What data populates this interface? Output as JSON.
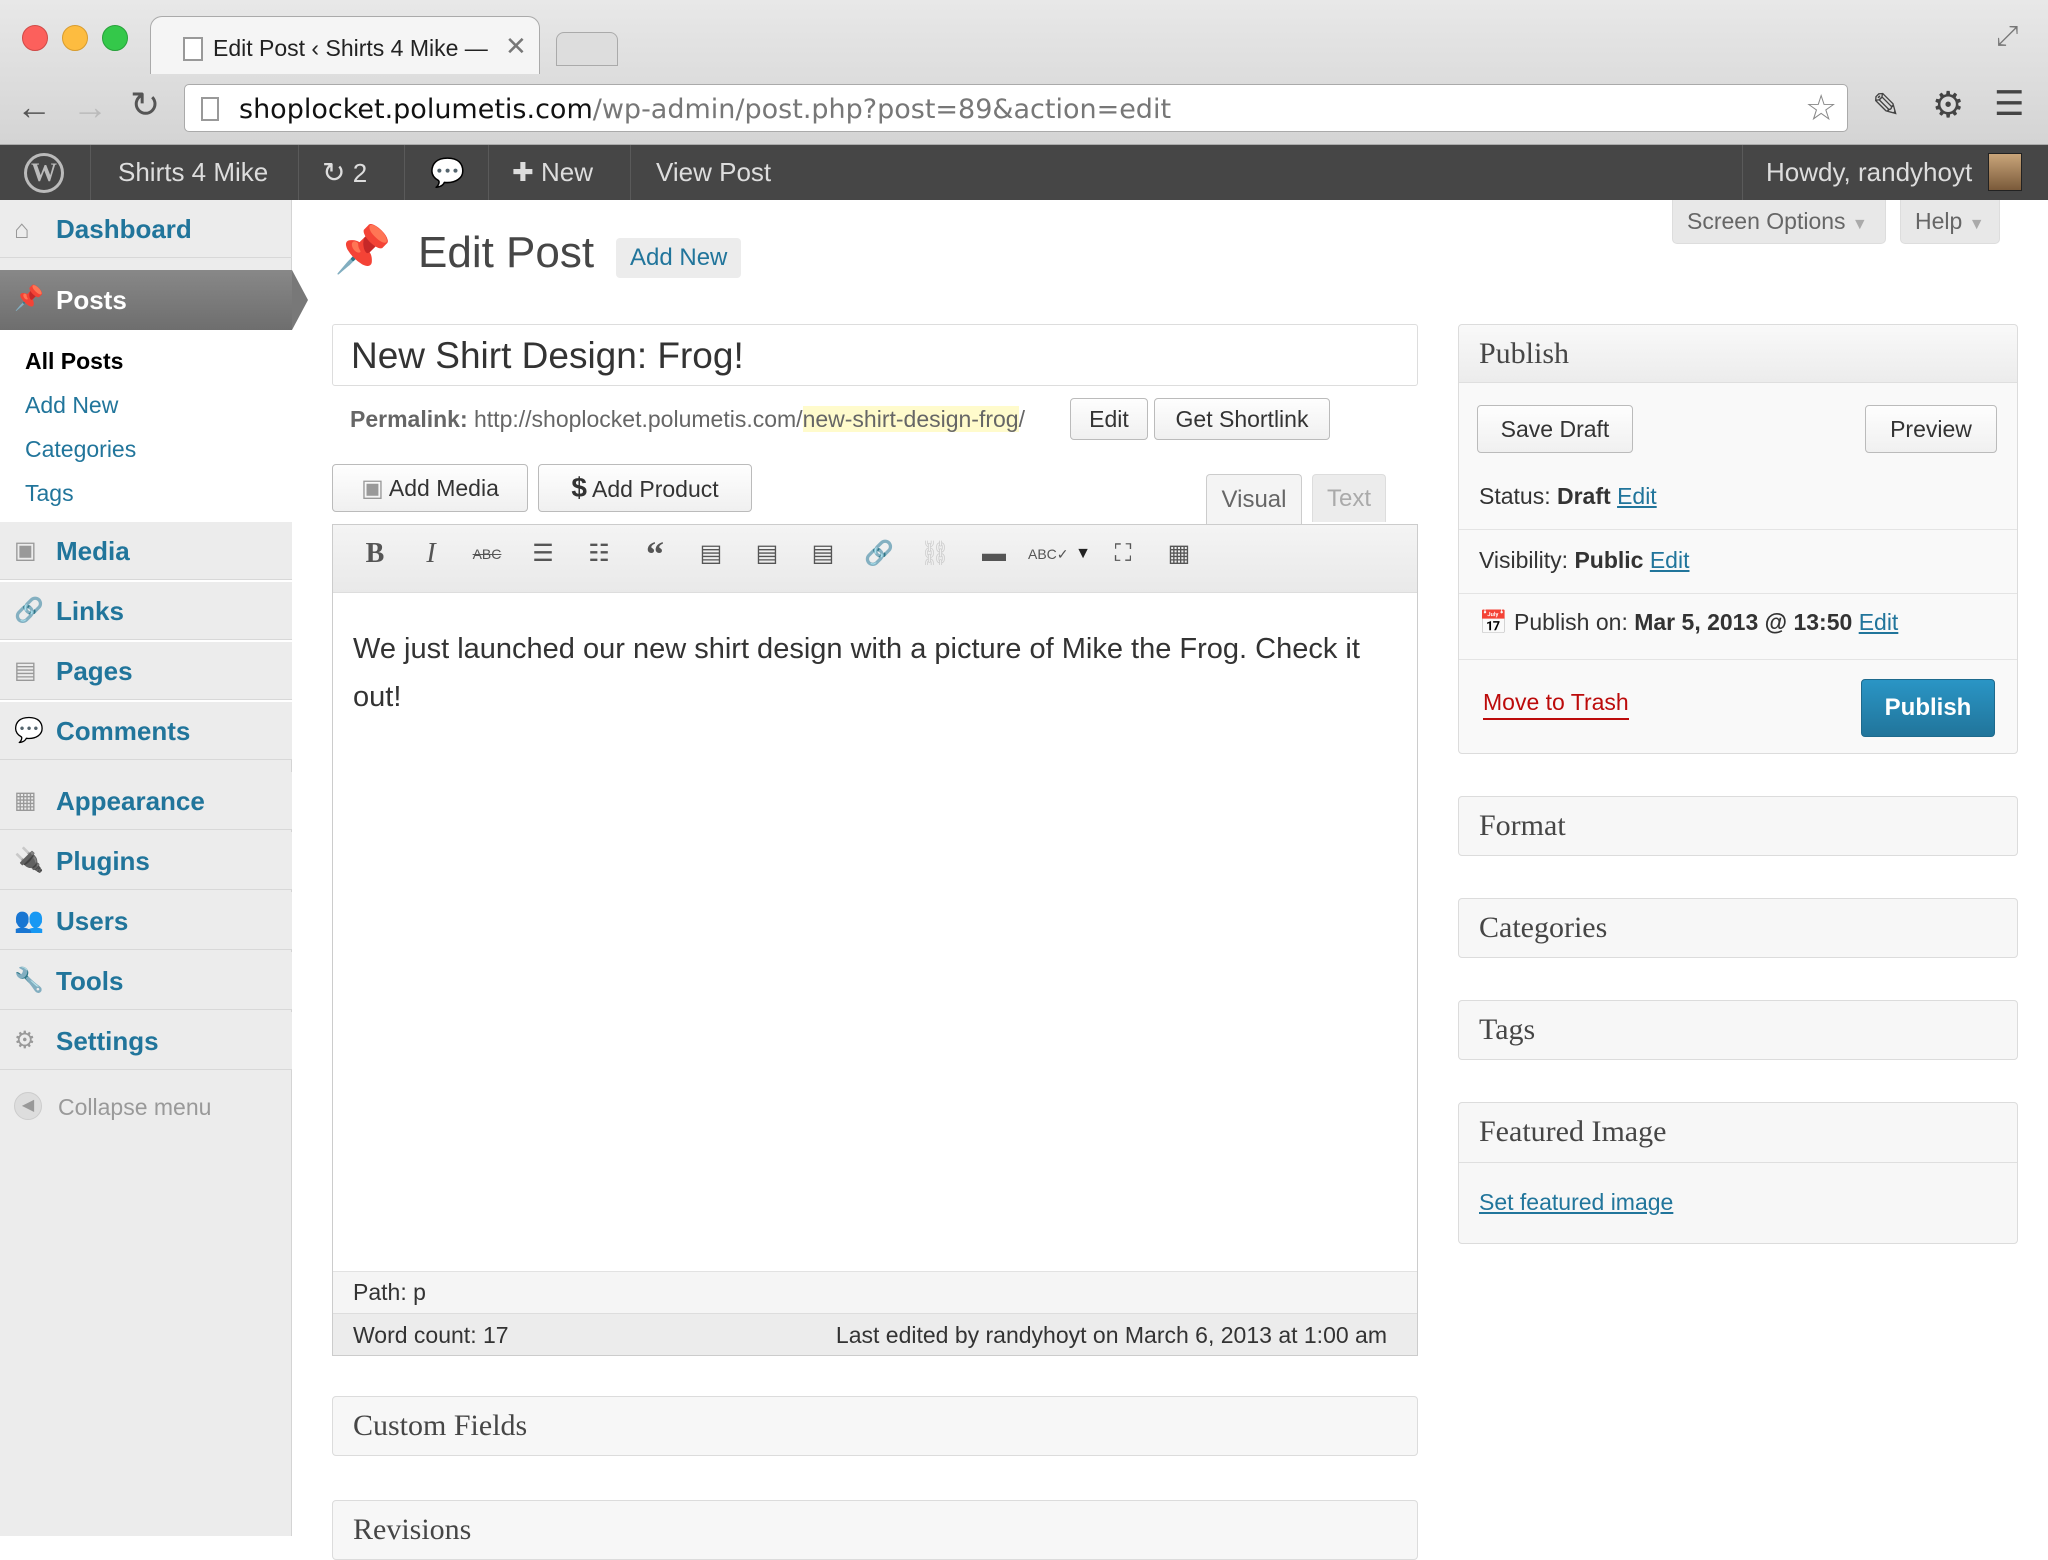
{
  "browser": {
    "tab_title": "Edit Post ‹ Shirts 4 Mike —",
    "url_host": "shoplocket.polumetis.com",
    "url_path": "/wp-admin/post.php?post=89&action=edit"
  },
  "adminbar": {
    "site_name": "Shirts 4 Mike",
    "updates_count": "2",
    "new_label": "New",
    "view_post": "View Post",
    "howdy": "Howdy, randyhoyt"
  },
  "sidebar": {
    "dashboard": "Dashboard",
    "posts": "Posts",
    "sub": [
      "All Posts",
      "Add New",
      "Categories",
      "Tags"
    ],
    "media": "Media",
    "links": "Links",
    "pages": "Pages",
    "comments": "Comments",
    "appearance": "Appearance",
    "plugins": "Plugins",
    "users": "Users",
    "tools": "Tools",
    "settings": "Settings",
    "collapse": "Collapse menu"
  },
  "screen_meta": {
    "screen_options": "Screen Options",
    "help": "Help"
  },
  "page": {
    "title": "Edit Post",
    "add_new": "Add New"
  },
  "post": {
    "title": "New Shirt Design: Frog!",
    "permalink_label": "Permalink:",
    "permalink_base": "http://shoplocket.polumetis.com/",
    "permalink_slug": "new-shirt-design-frog",
    "permalink_trail": "/",
    "edit_btn": "Edit",
    "shortlink_btn": "Get Shortlink",
    "add_media": "Add Media",
    "add_product": "Add Product",
    "tab_visual": "Visual",
    "tab_text": "Text",
    "content": "We just launched our new shirt design with a picture of Mike the Frog. Check it out!",
    "path": "Path: p",
    "word_count": "Word count: 17",
    "last_edited": "Last edited by randyhoyt on March 6, 2013 at 1:00 am"
  },
  "boxes": {
    "custom_fields": "Custom Fields",
    "revisions": "Revisions"
  },
  "publish": {
    "title": "Publish",
    "save_draft": "Save Draft",
    "preview": "Preview",
    "status_label": "Status:",
    "status_value": "Draft",
    "visibility_label": "Visibility:",
    "visibility_value": "Public",
    "publish_on_label": "Publish on:",
    "publish_on_value": "Mar 5, 2013 @ 13:50",
    "edit": "Edit",
    "trash": "Move to Trash",
    "publish_btn": "Publish"
  },
  "side_boxes": {
    "format": "Format",
    "categories": "Categories",
    "tags": "Tags",
    "featured_image": "Featured Image",
    "set_featured": "Set featured image"
  },
  "colors": {
    "accent": "#21759b",
    "publish_button": "#2a95c5",
    "trash": "#bc0b0b",
    "adminbar": "#464646"
  }
}
